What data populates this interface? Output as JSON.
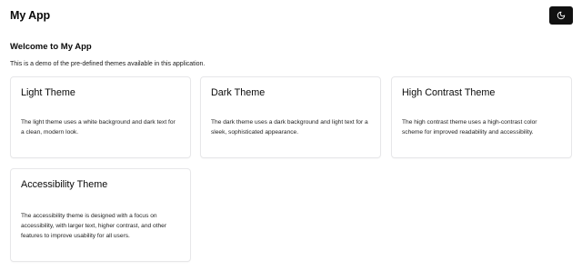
{
  "header": {
    "app_title": "My App",
    "theme_toggle_icon": "moon-icon"
  },
  "main": {
    "welcome_title": "Welcome to My App",
    "intro": "This is a demo of the pre-defined themes available in this application.",
    "cards": [
      {
        "title": "Light Theme",
        "description": "The light theme uses a white background and dark text for a clean, modern look."
      },
      {
        "title": "Dark Theme",
        "description": "The dark theme uses a dark background and light text for a sleek, sophisticated appearance."
      },
      {
        "title": "High Contrast Theme",
        "description": "The high contrast theme uses a high-contrast color scheme for improved readability and accessibility."
      },
      {
        "title": "Accessibility Theme",
        "description": "The accessibility theme is designed with a focus on accessibility, with larger text, higher contrast, and other features to improve usability for all users."
      }
    ]
  },
  "colors": {
    "button_background": "#111111",
    "card_border": "#e7e7e9",
    "background": "#ffffff"
  }
}
